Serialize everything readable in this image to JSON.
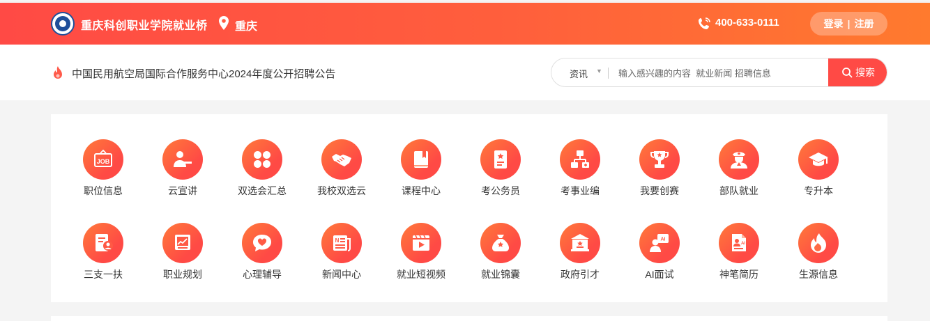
{
  "header": {
    "site_name": "重庆科创职业学院就业桥",
    "location": "重庆",
    "phone": "400-633-0111",
    "login_label": "登录",
    "register_label": "注册",
    "separator": "|"
  },
  "notice": {
    "text": "中国民用航空局国际合作服务中心2024年度公开招聘公告"
  },
  "search": {
    "category": "资讯",
    "placeholder": "输入感兴趣的内容  就业新闻 招聘信息",
    "button_label": "搜索"
  },
  "grid": {
    "items": [
      {
        "label": "职位信息",
        "icon": "job-board-icon"
      },
      {
        "label": "云宣讲",
        "icon": "presenter-icon"
      },
      {
        "label": "双选会汇总",
        "icon": "clover-icon"
      },
      {
        "label": "我校双选云",
        "icon": "handshake-icon"
      },
      {
        "label": "课程中心",
        "icon": "book-icon"
      },
      {
        "label": "考公务员",
        "icon": "document-star-icon"
      },
      {
        "label": "考事业编",
        "icon": "org-chart-icon"
      },
      {
        "label": "我要创赛",
        "icon": "trophy-icon"
      },
      {
        "label": "部队就业",
        "icon": "soldier-icon"
      },
      {
        "label": "专升本",
        "icon": "graduation-cap-icon"
      },
      {
        "label": "三支一扶",
        "icon": "resume-person-icon"
      },
      {
        "label": "职业规划",
        "icon": "trend-chart-icon"
      },
      {
        "label": "心理辅导",
        "icon": "heart-chat-icon"
      },
      {
        "label": "新闻中心",
        "icon": "newspaper-icon"
      },
      {
        "label": "就业短视频",
        "icon": "video-play-icon"
      },
      {
        "label": "就业锦囊",
        "icon": "money-bag-icon"
      },
      {
        "label": "政府引才",
        "icon": "government-building-icon"
      },
      {
        "label": "AI面试",
        "icon": "ai-interview-icon"
      },
      {
        "label": "神笔简历",
        "icon": "ai-resume-icon"
      },
      {
        "label": "生源信息",
        "icon": "flame-icon"
      }
    ]
  }
}
